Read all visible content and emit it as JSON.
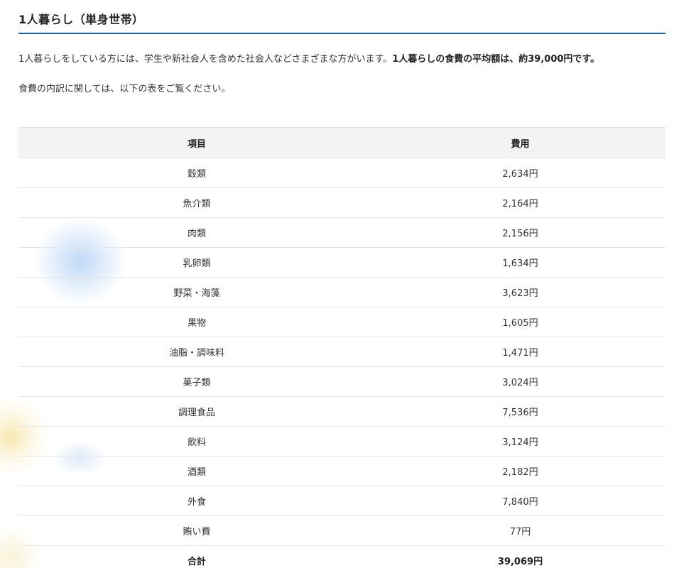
{
  "section": {
    "title": "1人暮らし（単身世帯）"
  },
  "intro": {
    "text_plain": "1人暮らしをしている方には、学生や新社会人を含めた社会人などさまざまな方がいます。",
    "text_bold": "1人暮らしの食費の平均額は、約39,000円です。",
    "breakdown_note": "食費の内訳に関しては、以下の表をご覧ください。"
  },
  "table": {
    "headers": {
      "item": "項目",
      "cost": "費用"
    },
    "rows": [
      {
        "item": "穀類",
        "cost": "2,634円"
      },
      {
        "item": "魚介類",
        "cost": "2,164円"
      },
      {
        "item": "肉類",
        "cost": "2,156円"
      },
      {
        "item": "乳卵類",
        "cost": "1,634円"
      },
      {
        "item": "野菜・海藻",
        "cost": "3,623円"
      },
      {
        "item": "果物",
        "cost": "1,605円"
      },
      {
        "item": "油脂・調味料",
        "cost": "1,471円"
      },
      {
        "item": "菓子類",
        "cost": "3,024円"
      },
      {
        "item": "調理食品",
        "cost": "7,536円"
      },
      {
        "item": "飲料",
        "cost": "3,124円"
      },
      {
        "item": "酒類",
        "cost": "2,182円"
      },
      {
        "item": "外食",
        "cost": "7,840円"
      },
      {
        "item": "賄い費",
        "cost": "77円"
      }
    ],
    "total": {
      "item": "合計",
      "cost": "39,069円"
    }
  },
  "colors": {
    "accent_rule": "#1d5fa8",
    "header_bg": "#f3f3f3",
    "row_border": "#e6e6e6"
  }
}
